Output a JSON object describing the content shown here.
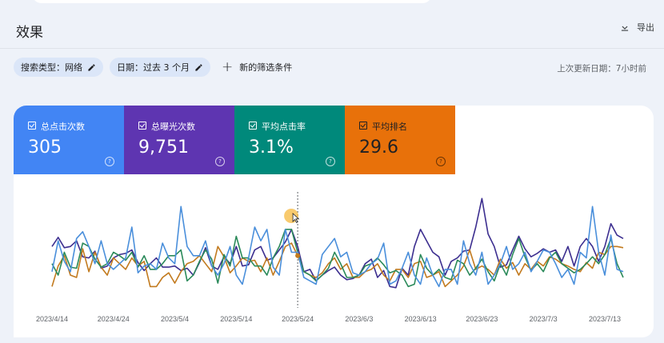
{
  "page": {
    "title": "效果",
    "export_label": "导出"
  },
  "filters": {
    "items": [
      {
        "label": "搜索类型：网络"
      },
      {
        "label": "日期：过去 3 个月"
      }
    ],
    "add_label": "新的筛选条件"
  },
  "last_update": "上次更新日期：7小时前",
  "metrics": [
    {
      "label": "总点击次数",
      "value": "305",
      "color": "#4285f4"
    },
    {
      "label": "总曝光次数",
      "value": "9,751",
      "color": "#5e35b1"
    },
    {
      "label": "平均点击率",
      "value": "3.1%",
      "color": "#00897b"
    },
    {
      "label": "平均排名",
      "value": "29.6",
      "color": "#e8710a"
    }
  ],
  "chart_data": {
    "type": "line",
    "x_ticks": [
      "2023/4/14",
      "2023/4/24",
      "2023/5/4",
      "2023/5/14",
      "2023/5/24",
      "2023/6/3",
      "2023/6/13",
      "2023/6/23",
      "2023/7/3",
      "2023/7/13"
    ],
    "x": [
      "2023/4/14",
      "2023/4/15",
      "2023/4/16",
      "2023/4/17",
      "2023/4/18",
      "2023/4/19",
      "2023/4/20",
      "2023/4/21",
      "2023/4/22",
      "2023/4/23",
      "2023/4/24",
      "2023/4/25",
      "2023/4/26",
      "2023/4/27",
      "2023/4/28",
      "2023/4/29",
      "2023/4/30",
      "2023/5/1",
      "2023/5/2",
      "2023/5/3",
      "2023/5/4",
      "2023/5/5",
      "2023/5/6",
      "2023/5/7",
      "2023/5/8",
      "2023/5/9",
      "2023/5/10",
      "2023/5/11",
      "2023/5/12",
      "2023/5/13",
      "2023/5/14",
      "2023/5/15",
      "2023/5/16",
      "2023/5/17",
      "2023/5/18",
      "2023/5/19",
      "2023/5/20",
      "2023/5/21",
      "2023/5/22",
      "2023/5/23",
      "2023/5/24",
      "2023/5/25",
      "2023/5/26",
      "2023/5/27",
      "2023/5/28",
      "2023/5/29",
      "2023/5/30",
      "2023/5/31",
      "2023/6/1",
      "2023/6/2",
      "2023/6/3",
      "2023/6/4",
      "2023/6/5",
      "2023/6/6",
      "2023/6/7",
      "2023/6/8",
      "2023/6/9",
      "2023/6/10",
      "2023/6/11",
      "2023/6/12",
      "2023/6/13",
      "2023/6/14",
      "2023/6/15",
      "2023/6/16",
      "2023/6/17",
      "2023/6/18",
      "2023/6/19",
      "2023/6/20",
      "2023/6/21",
      "2023/6/22",
      "2023/6/23",
      "2023/6/24",
      "2023/6/25",
      "2023/6/26",
      "2023/6/27",
      "2023/6/28",
      "2023/6/29",
      "2023/6/30",
      "2023/7/1",
      "2023/7/2",
      "2023/7/3",
      "2023/7/4",
      "2023/7/5",
      "2023/7/6",
      "2023/7/7",
      "2023/7/8",
      "2023/7/9",
      "2023/7/10",
      "2023/7/11",
      "2023/7/12",
      "2023/7/13",
      "2023/7/14",
      "2023/7/15",
      "2023/7/16"
    ],
    "series": [
      {
        "key": "impressions",
        "color": "#3c2e8f",
        "values": [
          0.55,
          0.63,
          0.54,
          0.55,
          0.6,
          0.46,
          0.45,
          0.51,
          0.36,
          0.38,
          0.45,
          0.48,
          0.49,
          0.52,
          0.41,
          0.34,
          0.4,
          0.45,
          0.37,
          0.37,
          0.38,
          0.34,
          0.36,
          0.3,
          0.41,
          0.54,
          0.38,
          0.35,
          0.46,
          0.4,
          0.55,
          0.38,
          0.39,
          0.52,
          0.55,
          0.43,
          0.45,
          0.52,
          0.59,
          0.7,
          0.55,
          0.33,
          0.35,
          0.25,
          0.3,
          0.34,
          0.37,
          0.3,
          0.26,
          0.27,
          0.3,
          0.4,
          0.44,
          0.28,
          0.34,
          0.2,
          0.19,
          0.36,
          0.3,
          0.55,
          0.7,
          0.6,
          0.5,
          0.46,
          0.3,
          0.42,
          0.45,
          0.51,
          0.52,
          0.72,
          0.97,
          0.66,
          0.55,
          0.37,
          0.39,
          0.52,
          0.64,
          0.53,
          0.46,
          0.49,
          0.53,
          0.5,
          0.52,
          0.42,
          0.55,
          0.38,
          0.55,
          0.62,
          0.55,
          0.42,
          0.55,
          0.75,
          0.65,
          0.62
        ]
      },
      {
        "key": "position",
        "color": "#c27a1e",
        "values": [
          0.2,
          0.38,
          0.47,
          0.3,
          0.28,
          0.53,
          0.33,
          0.5,
          0.37,
          0.3,
          0.45,
          0.4,
          0.35,
          0.45,
          0.38,
          0.42,
          0.2,
          0.2,
          0.28,
          0.32,
          0.23,
          0.33,
          0.4,
          0.42,
          0.47,
          0.4,
          0.33,
          0.55,
          0.46,
          0.32,
          0.38,
          0.45,
          0.42,
          0.43,
          0.33,
          0.45,
          0.3,
          0.42,
          0.55,
          0.58,
          0.47,
          0.33,
          0.3,
          0.28,
          0.32,
          0.4,
          0.45,
          0.35,
          0.4,
          0.28,
          0.28,
          0.33,
          0.35,
          0.4,
          0.3,
          0.25,
          0.35,
          0.35,
          0.28,
          0.4,
          0.42,
          0.28,
          0.3,
          0.33,
          0.2,
          0.25,
          0.3,
          0.38,
          0.52,
          0.35,
          0.38,
          0.35,
          0.3,
          0.44,
          0.36,
          0.41,
          0.3,
          0.4,
          0.35,
          0.42,
          0.38,
          0.46,
          0.44,
          0.4,
          0.38,
          0.35,
          0.33,
          0.41,
          0.36,
          0.5,
          0.48,
          0.55,
          0.55,
          0.54
        ]
      },
      {
        "key": "ctr",
        "color": "#2b8a5a",
        "values": [
          0.4,
          0.3,
          0.5,
          0.37,
          0.36,
          0.58,
          0.55,
          0.44,
          0.37,
          0.4,
          0.5,
          0.47,
          0.43,
          0.5,
          0.37,
          0.47,
          0.35,
          0.35,
          0.4,
          0.47,
          0.47,
          0.52,
          0.25,
          0.3,
          0.42,
          0.52,
          0.44,
          0.23,
          0.48,
          0.38,
          0.64,
          0.45,
          0.45,
          0.38,
          0.38,
          0.3,
          0.45,
          0.55,
          0.7,
          0.7,
          0.5,
          0.33,
          0.3,
          0.25,
          0.3,
          0.36,
          0.5,
          0.4,
          0.28,
          0.28,
          0.3,
          0.38,
          0.4,
          0.45,
          0.39,
          0.32,
          0.34,
          0.3,
          0.2,
          0.22,
          0.48,
          0.36,
          0.3,
          0.35,
          0.28,
          0.26,
          0.43,
          0.4,
          0.3,
          0.36,
          0.44,
          0.33,
          0.25,
          0.4,
          0.3,
          0.48,
          0.62,
          0.46,
          0.34,
          0.4,
          0.33,
          0.45,
          0.5,
          0.4,
          0.36,
          0.32,
          0.35,
          0.4,
          0.46,
          0.4,
          0.48,
          0.62,
          0.4,
          0.28
        ]
      },
      {
        "key": "clicks",
        "color": "#4a8fdb",
        "values": [
          0.33,
          0.6,
          0.42,
          0.33,
          0.62,
          0.68,
          0.55,
          0.4,
          0.6,
          0.4,
          0.35,
          0.4,
          0.45,
          0.72,
          0.32,
          0.38,
          0.4,
          0.35,
          0.58,
          0.45,
          0.4,
          0.9,
          0.55,
          0.47,
          0.47,
          0.6,
          0.38,
          0.3,
          0.4,
          0.55,
          0.3,
          0.22,
          0.45,
          0.72,
          0.6,
          0.7,
          0.37,
          0.3,
          0.7,
          0.5,
          0.5,
          0.28,
          0.25,
          0.22,
          0.48,
          0.55,
          0.62,
          0.46,
          0.5,
          0.32,
          0.3,
          0.33,
          0.4,
          0.44,
          0.58,
          0.22,
          0.25,
          0.36,
          0.5,
          0.3,
          0.22,
          0.45,
          0.3,
          0.2,
          0.35,
          0.35,
          0.22,
          0.6,
          0.4,
          0.3,
          0.5,
          0.22,
          0.3,
          0.4,
          0.55,
          0.35,
          0.4,
          0.5,
          0.33,
          0.42,
          0.52,
          0.5,
          0.4,
          0.28,
          0.35,
          0.22,
          0.5,
          0.45,
          0.9,
          0.5,
          0.3,
          0.65,
          0.35,
          0.33
        ]
      }
    ],
    "ylim": [
      0,
      1
    ]
  }
}
